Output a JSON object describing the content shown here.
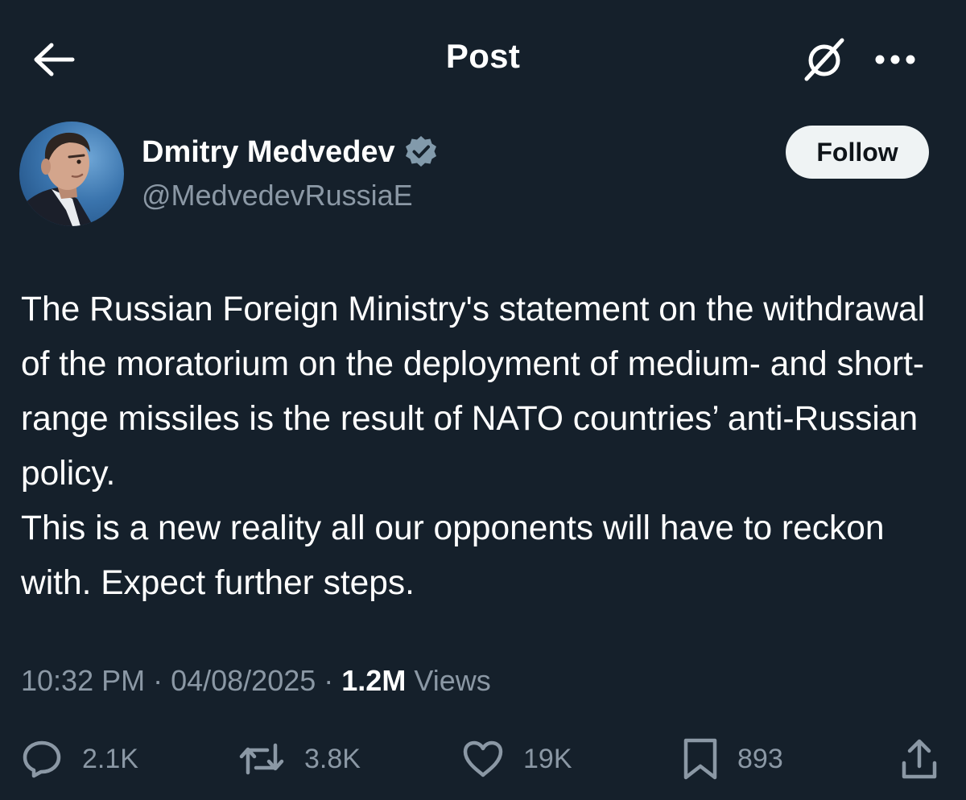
{
  "header": {
    "title": "Post"
  },
  "author": {
    "display_name": "Dmitry Medvedev",
    "handle": "@MedvedevRussiaE",
    "follow_label": "Follow"
  },
  "post": {
    "paragraphs": [
      "The Russian Foreign Ministry's statement on the withdrawal of the moratorium on the deployment of medium- and short-range missiles is the result of NATO countries’ anti-Russian policy.",
      "This is a new reality all our opponents will have to reckon with. Expect further steps."
    ]
  },
  "meta": {
    "time": "10:32 PM",
    "separator": " · ",
    "date": "04/08/2025",
    "views_count": "1.2M",
    "views_label": " Views"
  },
  "actions": {
    "replies": "2.1K",
    "reposts": "3.8K",
    "likes": "19K",
    "bookmarks": "893"
  },
  "icons": {
    "back": "arrow-left-icon",
    "grok": "grok-icon",
    "more": "more-horizontal-icon",
    "verified": "verified-badge-icon",
    "reply": "reply-icon",
    "repost": "repost-icon",
    "like": "heart-icon",
    "bookmark": "bookmark-icon",
    "share": "share-icon"
  },
  "colors": {
    "background": "#15202b",
    "text_primary": "#ffffff",
    "text_secondary": "#8b98a5",
    "follow_button_bg": "#eff3f4",
    "verified_badge": "#829aab"
  }
}
